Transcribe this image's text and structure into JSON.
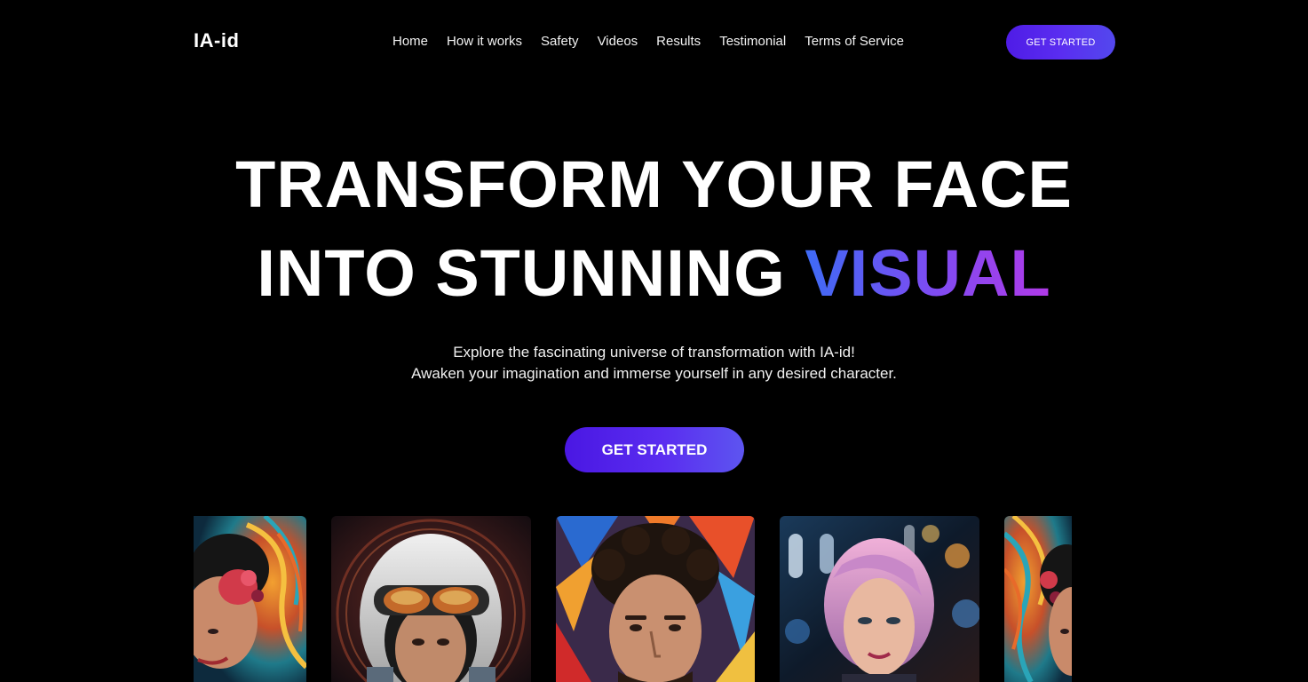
{
  "header": {
    "logo": "IA-id",
    "nav": [
      "Home",
      "How it works",
      "Safety",
      "Videos",
      "Results",
      "Testimonial",
      "Terms of Service"
    ],
    "cta_label": "GET STARTED"
  },
  "hero": {
    "line1": "TRANSFORM YOUR FACE",
    "line2_prefix": "INTO STUNNING ",
    "line2_accent": "VISUAL",
    "subtitle_line1": "Explore the fascinating universe of transformation with IA-id!",
    "subtitle_line2": "Awaken your imagination and immerse yourself in any desired character.",
    "cta_label": "GET STARTED"
  },
  "gallery": [
    {
      "subject": "woman with flower crown on psychedelic swirl background"
    },
    {
      "subject": "man in astronaut helmet with goggles"
    },
    {
      "subject": "curly-haired man on colorful paint splash background"
    },
    {
      "subject": "woman with pink hair at night city bokeh"
    },
    {
      "subject": "woman with flower crown on psychedelic swirl background"
    }
  ],
  "colors": {
    "background": "#000000",
    "accent_blue": "#3e6bf5",
    "accent_purple": "#b23ae8",
    "button": "#5a2df0"
  }
}
